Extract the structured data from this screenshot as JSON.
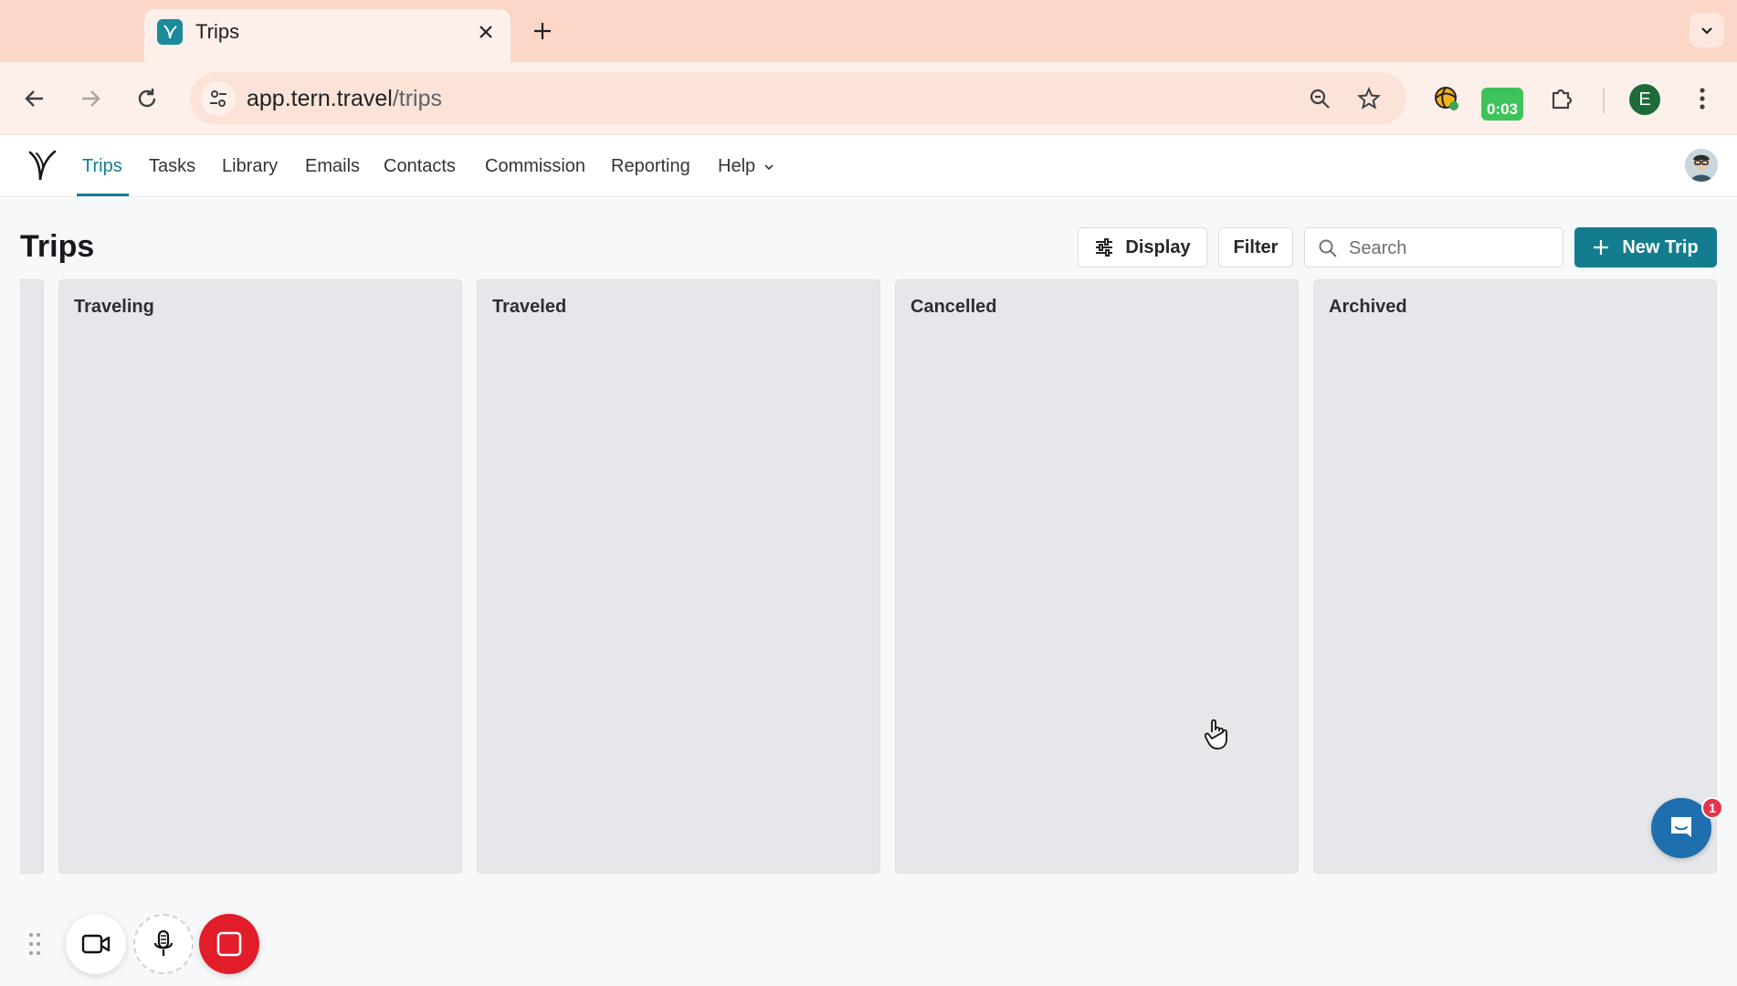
{
  "browser": {
    "tab_title": "Trips",
    "url_host": "app.tern.travel",
    "url_path": "/trips",
    "timer_ext_text": "0:03",
    "profile_initial": "E"
  },
  "appnav": {
    "items": [
      {
        "label": "Trips",
        "active": true
      },
      {
        "label": "Tasks"
      },
      {
        "label": "Library"
      },
      {
        "label": "Emails"
      },
      {
        "label": "Contacts"
      },
      {
        "label": "Commission"
      },
      {
        "label": "Reporting"
      },
      {
        "label": "Help"
      }
    ]
  },
  "page": {
    "title": "Trips",
    "display_label": "Display",
    "filter_label": "Filter",
    "search_placeholder": "Search",
    "new_trip_label": "New Trip",
    "columns": [
      {
        "title": "Traveling"
      },
      {
        "title": "Traveled"
      },
      {
        "title": "Cancelled"
      },
      {
        "title": "Archived"
      }
    ]
  },
  "chat": {
    "badge_count": "1"
  },
  "colors": {
    "accent": "#137d8f",
    "tabstrip": "#fcd7c7",
    "column_bg": "#e6e7ea",
    "record_red": "#e11d2a",
    "chat_blue": "#1f6fae"
  },
  "icons": [
    "back-arrow-icon",
    "forward-arrow-icon",
    "reload-icon",
    "site-settings-icon",
    "zoom-icon",
    "star-icon",
    "extension-puzzle-icon",
    "kebab-menu-icon",
    "sliders-icon",
    "search-icon",
    "plus-icon",
    "chat-icon",
    "video-camera-icon",
    "microphone-icon",
    "stop-icon"
  ]
}
